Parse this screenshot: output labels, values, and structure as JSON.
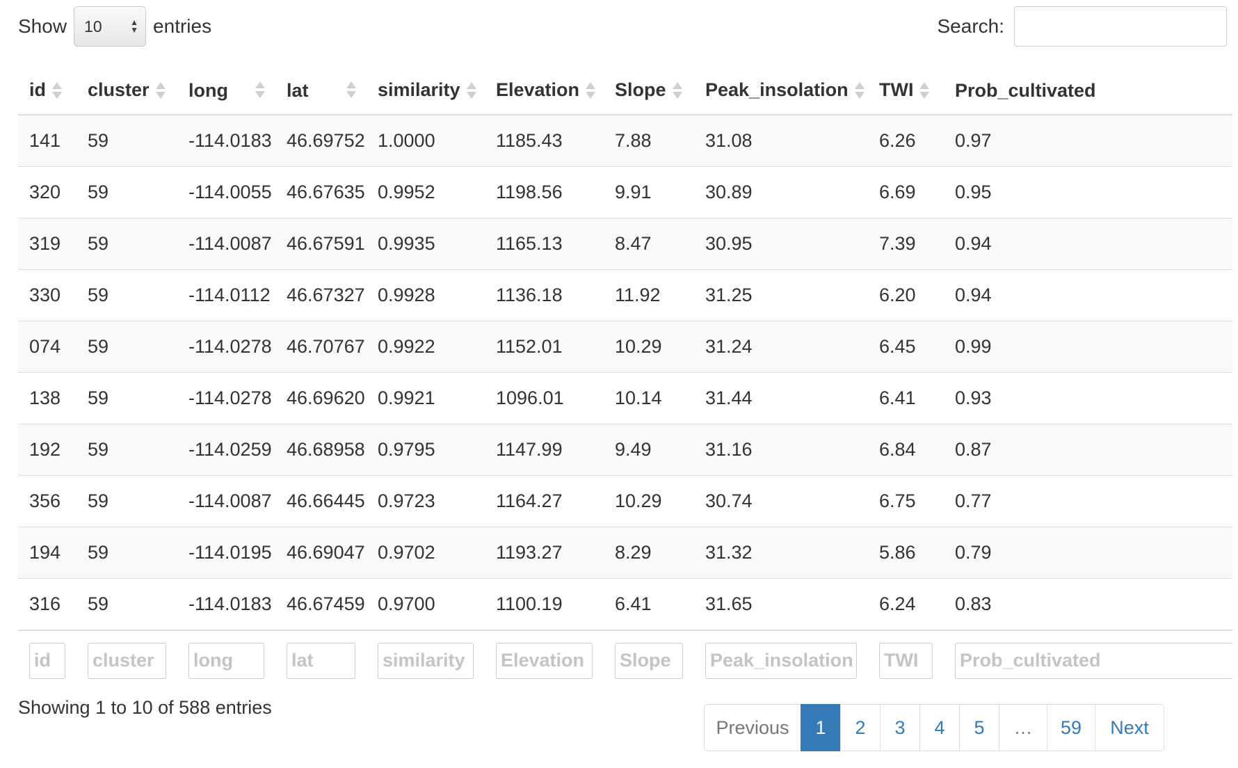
{
  "length_control": {
    "show_label": "Show",
    "selected": "10",
    "entries_label": "entries"
  },
  "search": {
    "label": "Search:",
    "value": ""
  },
  "columns": [
    "id",
    "cluster",
    "long",
    "lat",
    "similarity",
    "Elevation",
    "Slope",
    "Peak_insolation",
    "TWI",
    "Prob_cultivated"
  ],
  "rows": [
    [
      "141",
      "59",
      "-114.0183",
      "46.69752",
      "1.0000",
      "1185.43",
      "7.88",
      "31.08",
      "6.26",
      "0.97"
    ],
    [
      "320",
      "59",
      "-114.0055",
      "46.67635",
      "0.9952",
      "1198.56",
      "9.91",
      "30.89",
      "6.69",
      "0.95"
    ],
    [
      "319",
      "59",
      "-114.0087",
      "46.67591",
      "0.9935",
      "1165.13",
      "8.47",
      "30.95",
      "7.39",
      "0.94"
    ],
    [
      "330",
      "59",
      "-114.0112",
      "46.67327",
      "0.9928",
      "1136.18",
      "11.92",
      "31.25",
      "6.20",
      "0.94"
    ],
    [
      "074",
      "59",
      "-114.0278",
      "46.70767",
      "0.9922",
      "1152.01",
      "10.29",
      "31.24",
      "6.45",
      "0.99"
    ],
    [
      "138",
      "59",
      "-114.0278",
      "46.69620",
      "0.9921",
      "1096.01",
      "10.14",
      "31.44",
      "6.41",
      "0.93"
    ],
    [
      "192",
      "59",
      "-114.0259",
      "46.68958",
      "0.9795",
      "1147.99",
      "9.49",
      "31.16",
      "6.84",
      "0.87"
    ],
    [
      "356",
      "59",
      "-114.0087",
      "46.66445",
      "0.9723",
      "1164.27",
      "10.29",
      "30.74",
      "6.75",
      "0.77"
    ],
    [
      "194",
      "59",
      "-114.0195",
      "46.69047",
      "0.9702",
      "1193.27",
      "8.29",
      "31.32",
      "5.86",
      "0.79"
    ],
    [
      "316",
      "59",
      "-114.0183",
      "46.67459",
      "0.9700",
      "1100.19",
      "6.41",
      "31.65",
      "6.24",
      "0.83"
    ]
  ],
  "info": "Showing 1 to 10 of 588 entries",
  "pagination": {
    "previous": "Previous",
    "pages": [
      "1",
      "2",
      "3",
      "4",
      "5",
      "…",
      "59"
    ],
    "next": "Next"
  },
  "colors": {
    "accent": "#337ab7",
    "stripe": "#f9f9f9",
    "border": "#dddddd"
  }
}
